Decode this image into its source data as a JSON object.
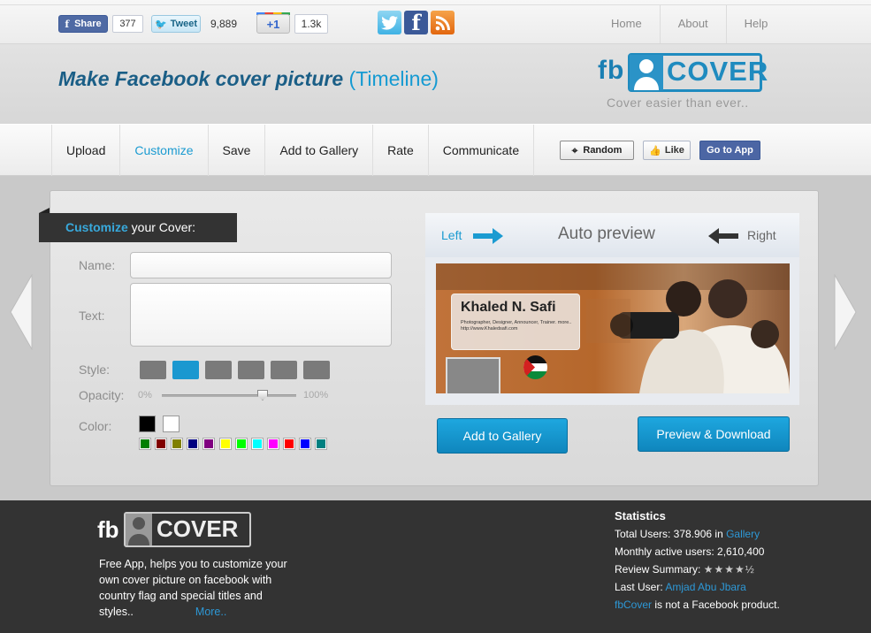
{
  "social": {
    "share_label": "Share",
    "share_count": "377",
    "tweet_label": "Tweet",
    "tweet_count": "9,889",
    "plusone_label": "+1",
    "plusone_count": "1.3k",
    "icons": [
      "twitter-icon",
      "facebook-icon",
      "rss-icon"
    ]
  },
  "topnav": [
    {
      "label": "Home"
    },
    {
      "label": "About"
    },
    {
      "label": "Help"
    }
  ],
  "header": {
    "title_main": "Make Facebook cover picture ",
    "title_highlight": "(Timeline)",
    "logo_fb": "fb",
    "logo_cover": "COVER",
    "tagline": "Cover easier than ever.."
  },
  "menu": [
    {
      "label": "Upload",
      "active": false
    },
    {
      "label": "Customize",
      "active": true
    },
    {
      "label": "Save",
      "active": false
    },
    {
      "label": "Add to Gallery",
      "active": false
    },
    {
      "label": "Rate",
      "active": false
    },
    {
      "label": "Communicate",
      "active": false
    }
  ],
  "actions": {
    "random_label": "Random",
    "like_label": "Like",
    "goapp_label": "Go to App"
  },
  "customize": {
    "heading_highlight": "Customize",
    "heading_rest": " your Cover:",
    "name_label": "Name:",
    "name_value": "",
    "text_label": "Text:",
    "text_value": "",
    "style_label": "Style:",
    "style_count": 6,
    "style_selected": 1,
    "opacity_label": "Opacity:",
    "opacity_min": "0%",
    "opacity_max": "100%",
    "opacity_value": 0.75,
    "color_label": "Color:",
    "main_colors": [
      "#000000",
      "#ffffff"
    ],
    "palette": [
      "#008000",
      "#800000",
      "#808000",
      "#000080",
      "#800080",
      "#ffff00",
      "#00ff00",
      "#00ffff",
      "#ff00ff",
      "#ff0000",
      "#0000ff",
      "#008080"
    ]
  },
  "preview": {
    "left_label": "Left",
    "title": "Auto preview",
    "right_label": "Right",
    "card_name": "Khaled N. Safi",
    "card_desc": "Photographer, Designer, Announcer, Trainer. more.. http://www.Khaledsafi.com"
  },
  "buttons": {
    "gallery": "Add to Gallery",
    "download": "Preview & Download"
  },
  "footer": {
    "logo_fb": "fb",
    "logo_cover": "COVER",
    "description": "Free App, helps you to customize your own cover picture on facebook with country flag and special titles and styles..",
    "more": "More..",
    "stats_title": "Statistics",
    "total_users_label": "Total Users: 378.906 in ",
    "gallery_link": "Gallery",
    "monthly_label": "Monthly active users:  2,610,400",
    "review_label": "Review Summary: ",
    "review_stars": "★★★★½",
    "last_user_label": "Last User: ",
    "last_user": "Amjad Abu Jbara",
    "brand_link": "fbCover",
    "disclaimer": " is not a Facebook product."
  },
  "colors": {
    "accent": "#1b9bd1",
    "title": "#1a5e86",
    "footer_bg": "#333333"
  }
}
